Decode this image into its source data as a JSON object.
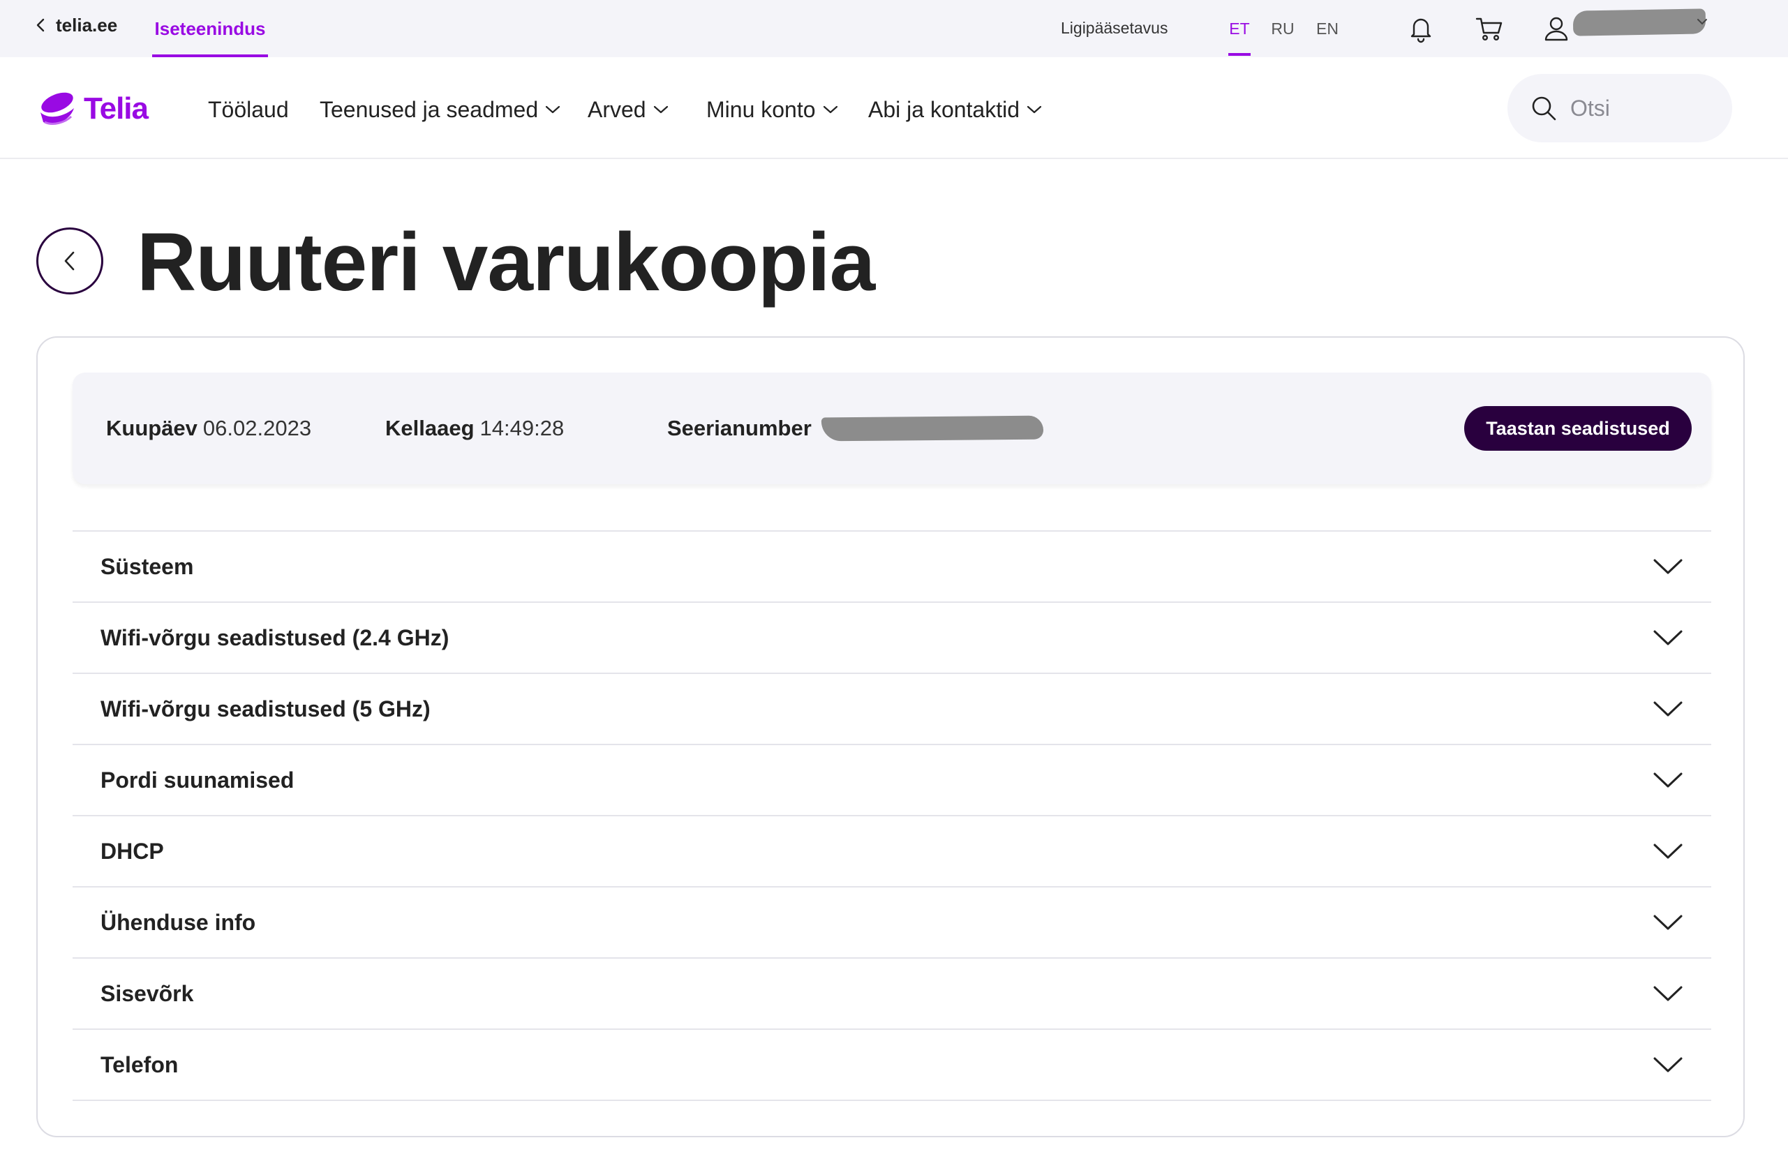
{
  "topbar": {
    "back_link": "telia.ee",
    "self_service": "Iseteenindus",
    "accessibility": "Ligipääsetavus",
    "languages": [
      "ET",
      "RU",
      "EN"
    ],
    "active_language": "ET"
  },
  "nav": {
    "logo": "Telia",
    "items": [
      {
        "label": "Töölaud",
        "has_dropdown": false
      },
      {
        "label": "Teenused ja seadmed",
        "has_dropdown": true
      },
      {
        "label": "Arved",
        "has_dropdown": true
      },
      {
        "label": "Minu konto",
        "has_dropdown": true
      },
      {
        "label": "Abi ja kontaktid",
        "has_dropdown": true
      }
    ],
    "search_placeholder": "Otsi"
  },
  "page": {
    "title": "Ruuteri varukoopia"
  },
  "backup_info": {
    "date_label": "Kuupäev",
    "date_value": "06.02.2023",
    "time_label": "Kellaaeg",
    "time_value": "14:49:28",
    "serial_label": "Seerianumber",
    "restore_button": "Taastan seadistused"
  },
  "sections": [
    {
      "label": "Süsteem"
    },
    {
      "label": "Wifi-võrgu seadistused (2.4 GHz)"
    },
    {
      "label": "Wifi-võrgu seadistused (5 GHz)"
    },
    {
      "label": "Pordi suunamised"
    },
    {
      "label": "DHCP"
    },
    {
      "label": "Ühenduse info"
    },
    {
      "label": "Sisevõrk"
    },
    {
      "label": "Telefon"
    }
  ],
  "colors": {
    "brand_purple": "#990ae3",
    "dark_purple": "#29003e",
    "surface": "#f4f4f9"
  }
}
